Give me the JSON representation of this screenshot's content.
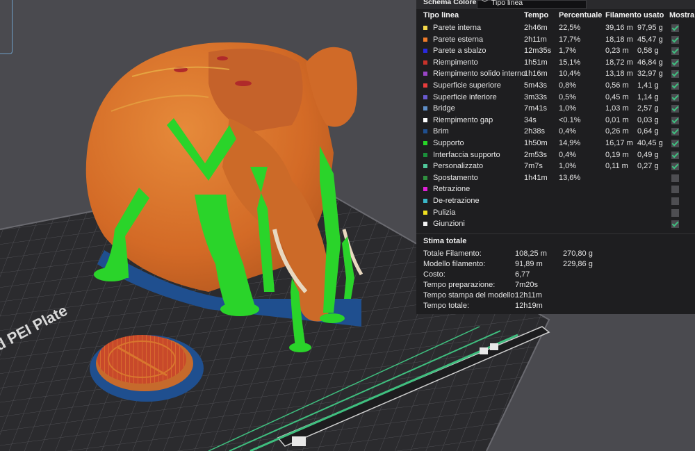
{
  "header": {
    "label": "Schema Colore",
    "selected_option": "Tipo linea"
  },
  "columns": {
    "type": "Tipo linea",
    "time": "Tempo",
    "percent": "Percentuale",
    "filament": "Filamento usato",
    "show": "Mostra"
  },
  "rows": [
    {
      "name": "Parete interna",
      "color": "#f5d84a",
      "time": "2h46m",
      "percent": "22,5%",
      "meters": "39,16 m",
      "grams": "97,95 g",
      "shown": true
    },
    {
      "name": "Parete esterna",
      "color": "#f07b2a",
      "time": "2h11m",
      "percent": "17,7%",
      "meters": "18,18 m",
      "grams": "45,47 g",
      "shown": true
    },
    {
      "name": "Parete a sbalzo",
      "color": "#2a2ae0",
      "time": "12m35s",
      "percent": "1,7%",
      "meters": "0,23 m",
      "grams": "0,58 g",
      "shown": true
    },
    {
      "name": "Riempimento",
      "color": "#c8322a",
      "time": "1h51m",
      "percent": "15,1%",
      "meters": "18,72 m",
      "grams": "46,84 g",
      "shown": true
    },
    {
      "name": "Riempimento solido interno",
      "color": "#9a45c6",
      "time": "1h16m",
      "percent": "10,4%",
      "meters": "13,18 m",
      "grams": "32,97 g",
      "shown": true
    },
    {
      "name": "Superficie superiore",
      "color": "#e83c3c",
      "time": "5m43s",
      "percent": "0,8%",
      "meters": "0,56 m",
      "grams": "1,41 g",
      "shown": true
    },
    {
      "name": "Superficie inferiore",
      "color": "#6a5ad0",
      "time": "3m33s",
      "percent": "0,5%",
      "meters": "0,45 m",
      "grams": "1,14 g",
      "shown": true
    },
    {
      "name": "Bridge",
      "color": "#5f8fc8",
      "time": "7m41s",
      "percent": "1,0%",
      "meters": "1,03 m",
      "grams": "2,57 g",
      "shown": true
    },
    {
      "name": "Riempimento gap",
      "color": "#ffffff",
      "time": "34s",
      "percent": "<0.1%",
      "meters": "0,01 m",
      "grams": "0,03 g",
      "shown": true
    },
    {
      "name": "Brim",
      "color": "#1f4f8f",
      "time": "2h38s",
      "percent": "0,4%",
      "meters": "0,26 m",
      "grams": "0,64 g",
      "shown": true
    },
    {
      "name": "Supporto",
      "color": "#27d627",
      "time": "1h50m",
      "percent": "14,9%",
      "meters": "16,17 m",
      "grams": "40,45 g",
      "shown": true
    },
    {
      "name": "Interfaccia supporto",
      "color": "#1a8f3a",
      "time": "2m53s",
      "percent": "0,4%",
      "meters": "0,19 m",
      "grams": "0,49 g",
      "shown": true
    },
    {
      "name": "Personalizzato",
      "color": "#4fc79a",
      "time": "7m7s",
      "percent": "1,0%",
      "meters": "0,11 m",
      "grams": "0,27 g",
      "shown": true
    },
    {
      "name": "Spostamento",
      "color": "#2f8f3f",
      "time": "1h41m",
      "percent": "13,6%",
      "meters": "",
      "grams": "",
      "shown": false
    },
    {
      "name": "Retrazione",
      "color": "#e020d8",
      "time": "",
      "percent": "",
      "meters": "",
      "grams": "",
      "shown": false
    },
    {
      "name": "De-retrazione",
      "color": "#3ab7c8",
      "time": "",
      "percent": "",
      "meters": "",
      "grams": "",
      "shown": false
    },
    {
      "name": "Pulizia",
      "color": "#f0e020",
      "time": "",
      "percent": "",
      "meters": "",
      "grams": "",
      "shown": false
    },
    {
      "name": "Giunzioni",
      "color": "#f2f2f2",
      "time": "",
      "percent": "",
      "meters": "",
      "grams": "",
      "shown": true
    }
  ],
  "estimate": {
    "title": "Stima totale",
    "rows": [
      {
        "label": "Totale Filamento:",
        "value": "108,25 m",
        "value2": "270,80 g"
      },
      {
        "label": "Modello filamento:",
        "value": "91,89 m",
        "value2": "229,86 g"
      },
      {
        "label": "Costo:",
        "value": "6,77",
        "value2": ""
      },
      {
        "label": "Tempo preparazione:",
        "value": "7m20s",
        "value2": ""
      },
      {
        "label": "Tempo stampa del modello:",
        "value": "12h11m",
        "value2": ""
      },
      {
        "label": "Tempo totale:",
        "value": "12h19m",
        "value2": ""
      }
    ]
  },
  "plate": {
    "label": "d PEI Plate"
  },
  "colors": {
    "panel_bg": "#1e1e20",
    "bed": "#2b2b2e",
    "grid": "#5a5a5f",
    "model_orange": "#d8712c",
    "support_green": "#27d627",
    "brim_blue": "#1f4f8f",
    "accent_green": "#3fbf7f"
  }
}
